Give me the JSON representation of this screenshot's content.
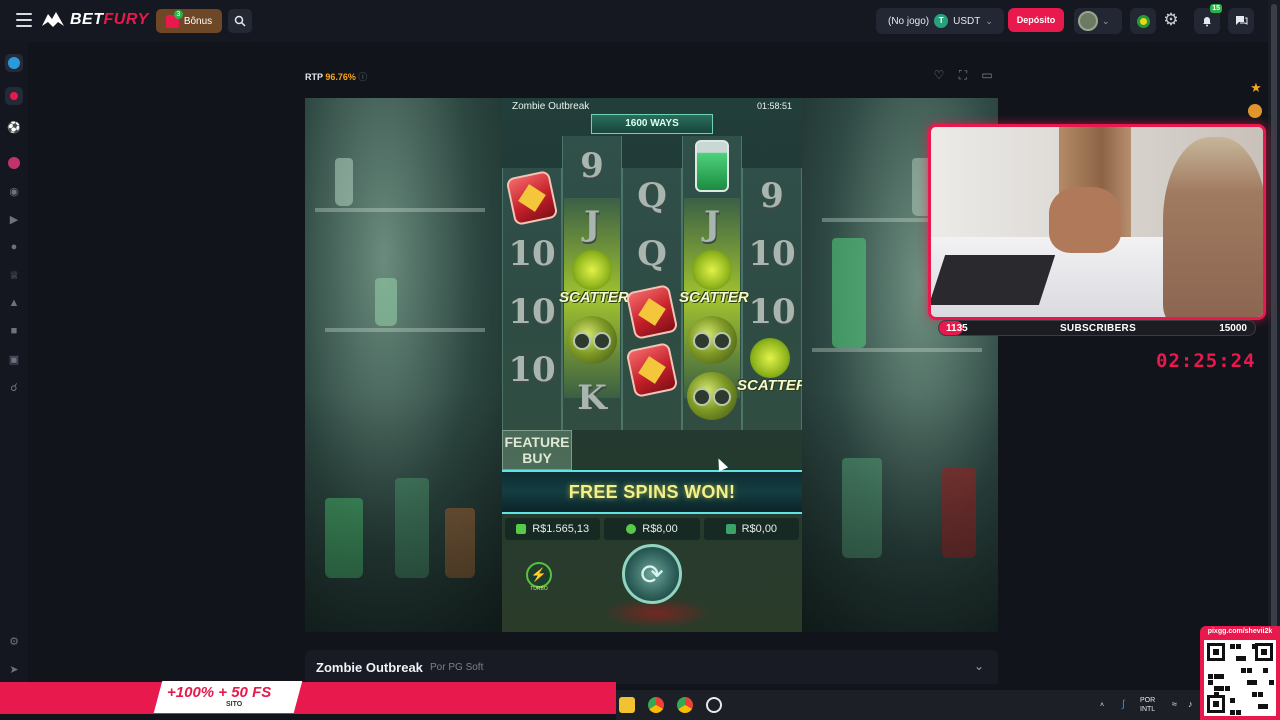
{
  "header": {
    "logo_bet": "BET",
    "logo_fury": "FURY",
    "bonus_label": "Bônus",
    "bonus_count": "3",
    "wallet_mode": "(No jogo)",
    "wallet_currency": "USDT",
    "wallet_coin": "T",
    "deposit_label": "Depósito",
    "notifications_count": "15"
  },
  "game": {
    "rtp_label": "RTP",
    "rtp_value": "96.76%",
    "title": "Zombie Outbreak",
    "clock": "01:58:51",
    "ways": "1600 WAYS",
    "scatter_label": "SCATTER",
    "feature_buy": "FEATURE BUY",
    "win_banner": "FREE SPINS WON!",
    "balance": "R$1.565,13",
    "bet": "R$8,00",
    "win": "R$0,00",
    "turbo_label": "TURBO",
    "symbols": {
      "nine": "9",
      "j": "J",
      "q": "Q",
      "ten": "10",
      "k": "K"
    }
  },
  "game_info": {
    "title": "Zombie Outbreak",
    "provider": "Por PG Soft"
  },
  "stream": {
    "subs_current": "1135",
    "subs_label": "SUBSCRIBERS",
    "subs_goal": "15000",
    "subs_progress": 0.0757,
    "timer": "02:25:24",
    "qr_url": "pixgg.com/shevii2k",
    "promo_text": "+100% + 50 FS",
    "promo_sub": "SITO"
  },
  "taskbar": {
    "language": "POR",
    "layout": "INTL"
  },
  "colors": {
    "brand": "#e8194c",
    "accent_gold": "#f5a623",
    "usdt": "#26a17b"
  }
}
